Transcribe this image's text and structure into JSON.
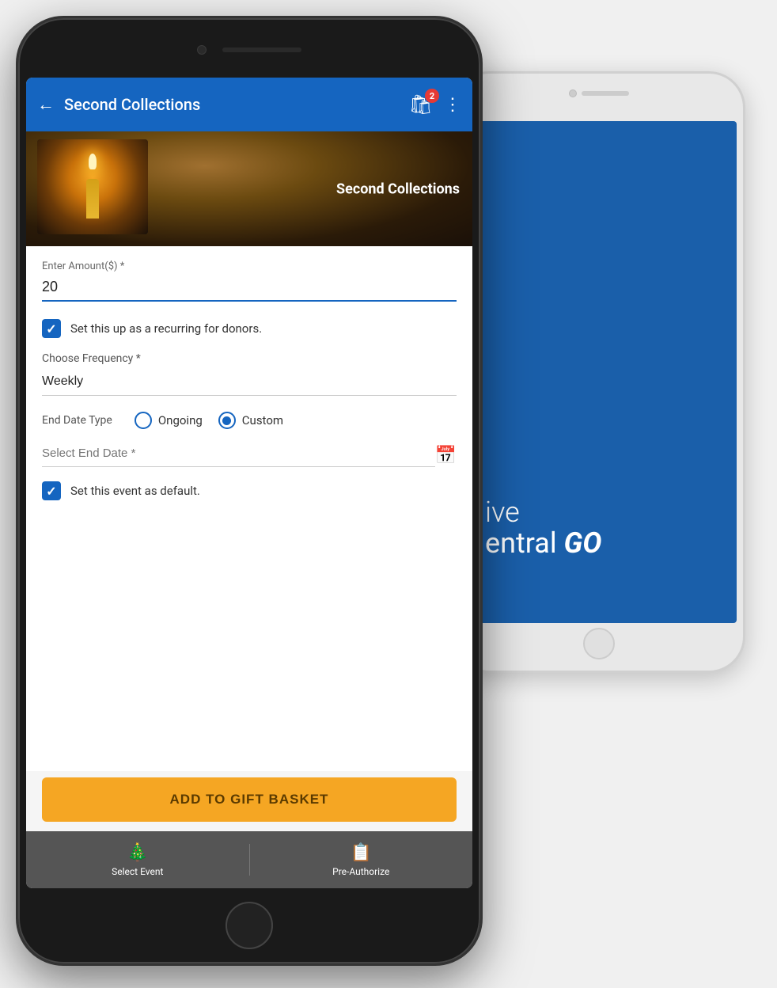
{
  "bg_phone": {
    "camera_alt": "camera",
    "speaker_alt": "speaker",
    "home_alt": "home button",
    "blue_text_line1": "ive",
    "blue_text_line2": "entral",
    "blue_text_go": "GO"
  },
  "header": {
    "title": "Second Collections",
    "back_label": "←",
    "basket_badge": "2",
    "more_label": "⋮"
  },
  "hero": {
    "title": "Second Collections"
  },
  "form": {
    "amount_label": "Enter Amount($) *",
    "amount_value": "20",
    "recurring_label": "Set this up as a recurring for donors.",
    "frequency_label": "Choose Frequency *",
    "frequency_value": "Weekly",
    "end_date_type_label": "End Date Type",
    "ongoing_label": "Ongoing",
    "custom_label": "Custom",
    "end_date_label": "Select End Date *",
    "end_date_placeholder": "",
    "default_label": "Set this event as default.",
    "add_basket_label": "ADD TO GIFT BASKET"
  },
  "bottom_nav": {
    "event_label": "Select Event",
    "preauth_label": "Pre-Authorize"
  }
}
